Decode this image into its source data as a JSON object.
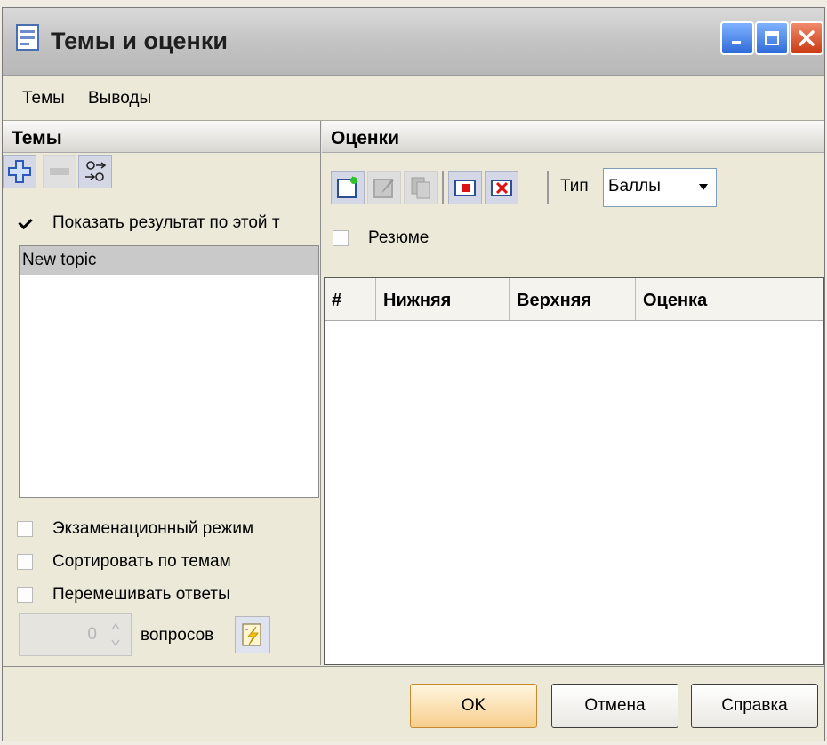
{
  "window": {
    "title": "Темы и оценки"
  },
  "menu": {
    "items": [
      "Темы",
      "Выводы"
    ]
  },
  "topics_panel": {
    "title": "Темы",
    "show_result_label": "Показать результат по этой т",
    "show_result_checked": true,
    "topics": [
      "New topic"
    ],
    "exam_mode_label": "Экзаменационный режим",
    "sort_by_topics_label": "Сортировать по темам",
    "shuffle_answers_label": "Перемешивать ответы",
    "questions_count": "0",
    "questions_label": "вопросов"
  },
  "grades_panel": {
    "title": "Оценки",
    "type_label": "Тип",
    "type_value": "Баллы",
    "summary_label": "Резюме",
    "columns": [
      "#",
      "Нижняя",
      "Верхняя",
      "Оценка"
    ]
  },
  "buttons": {
    "ok": "OK",
    "cancel": "Отмена",
    "help": "Справка"
  },
  "colors": {
    "accent_blue": "#2f6bd8",
    "close_red": "#c93a12",
    "ok_highlight": "#f8ce8d"
  }
}
